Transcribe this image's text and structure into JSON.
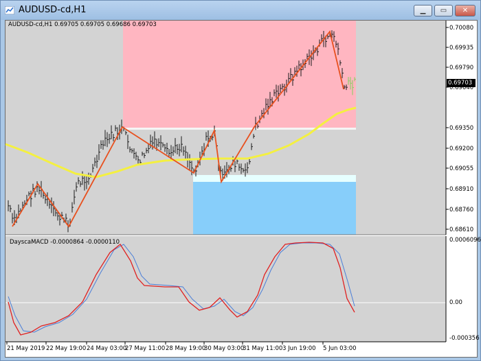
{
  "window": {
    "title": "AUDUSD-cd,H1",
    "controls": [
      "minimize",
      "restore",
      "close"
    ]
  },
  "chart": {
    "ohlc_header": "AUDUSD-cd,H1  0.69705 0.69705 0.69686 0.69703",
    "current_price": "0.69703",
    "price_labels": [
      "0.70080",
      "0.69935",
      "0.69790",
      "0.69640",
      "0.69495",
      "0.69350",
      "0.69200",
      "0.69055",
      "0.68910",
      "0.68760",
      "0.68610"
    ],
    "time_labels": [
      "21 May 2019",
      "22 May 19:00",
      "24 May 03:00",
      "27 May 11:00",
      "28 May 19:00",
      "30 May 03:00",
      "31 May 11:00",
      "3 Jun 19:00",
      "5 Jun 03:00"
    ],
    "colors": {
      "background": "#d3d3d3",
      "bars": "#1a1a1a",
      "zigzag": "#e8501e",
      "moving_average": "#f4f040",
      "supply_zone": "#ffb6c1",
      "demand_zone": "#87cefa",
      "last_bar": "#7fd060"
    }
  },
  "indicator": {
    "header": "DayscaMACD -0.0000864 -0.0000110",
    "scale_labels": [
      "0.0006096",
      "0.00",
      "-0.000356"
    ],
    "colors": {
      "macd": "#e02020",
      "signal": "#4a7ed8",
      "zero_line": "#ffffff"
    }
  }
}
